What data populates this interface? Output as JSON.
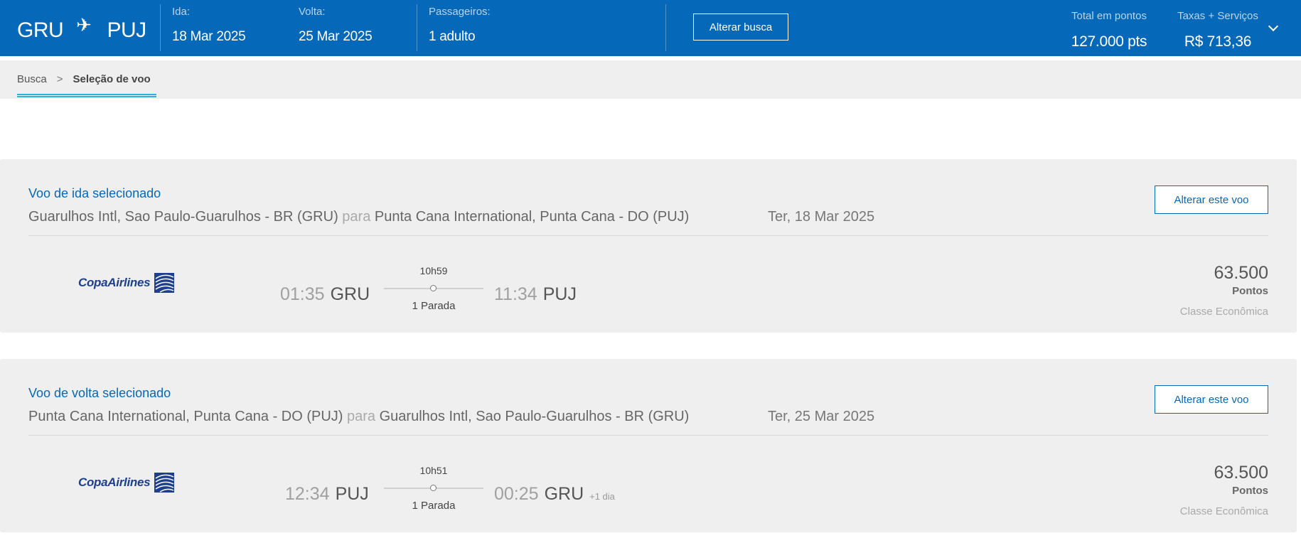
{
  "header": {
    "origin": "GRU",
    "destination": "PUJ",
    "ida_label": "Ida:",
    "ida_value": "18 Mar 2025",
    "volta_label": "Volta:",
    "volta_value": "25 Mar 2025",
    "passageiros_label": "Passageiros:",
    "passageiros_value": "1 adulto",
    "alterar_busca": "Alterar busca",
    "total_label": "Total em pontos",
    "total_value": "127.000 pts",
    "taxas_label": "Taxas + Serviços",
    "taxas_value": "R$ 713,36"
  },
  "breadcrumb": {
    "step1": "Busca",
    "separator": ">",
    "step2": "Seleção de voo"
  },
  "outbound": {
    "title": "Voo de ida selecionado",
    "from": "Guarulhos Intl, Sao Paulo-Guarulhos - BR (GRU)",
    "para": "para",
    "to": "Punta Cana International, Punta Cana - DO (PUJ)",
    "date": "Ter, 18 Mar 2025",
    "change_label": "Alterar este voo",
    "airline_text": "CopaAirlines",
    "dep_time": "01:35",
    "dep_code": "GRU",
    "duration": "10h59",
    "stops": "1 Parada",
    "arr_time": "11:34",
    "arr_code": "PUJ",
    "points": "63.500",
    "points_unit": "Pontos",
    "cabin": "Classe Econômica"
  },
  "inbound": {
    "title": "Voo de volta selecionado",
    "from": "Punta Cana International, Punta Cana - DO (PUJ)",
    "para": "para",
    "to": "Guarulhos Intl, Sao Paulo-Guarulhos - BR (GRU)",
    "date": "Ter, 25 Mar 2025",
    "change_label": "Alterar este voo",
    "airline_text": "CopaAirlines",
    "dep_time": "12:34",
    "dep_code": "PUJ",
    "duration": "10h51",
    "stops": "1 Parada",
    "arr_time": "00:25",
    "arr_code": "GRU",
    "arr_plus": "+1 dia",
    "points": "63.500",
    "points_unit": "Pontos",
    "cabin": "Classe Econômica"
  },
  "colors": {
    "header_bg": "#0568b8",
    "accent": "#27b4e4",
    "card_bg": "#efefef"
  },
  "icons": {
    "plane": "airplane-icon",
    "chevron": "chevron-down-icon",
    "airline_logo": "copa-airlines-logo"
  }
}
